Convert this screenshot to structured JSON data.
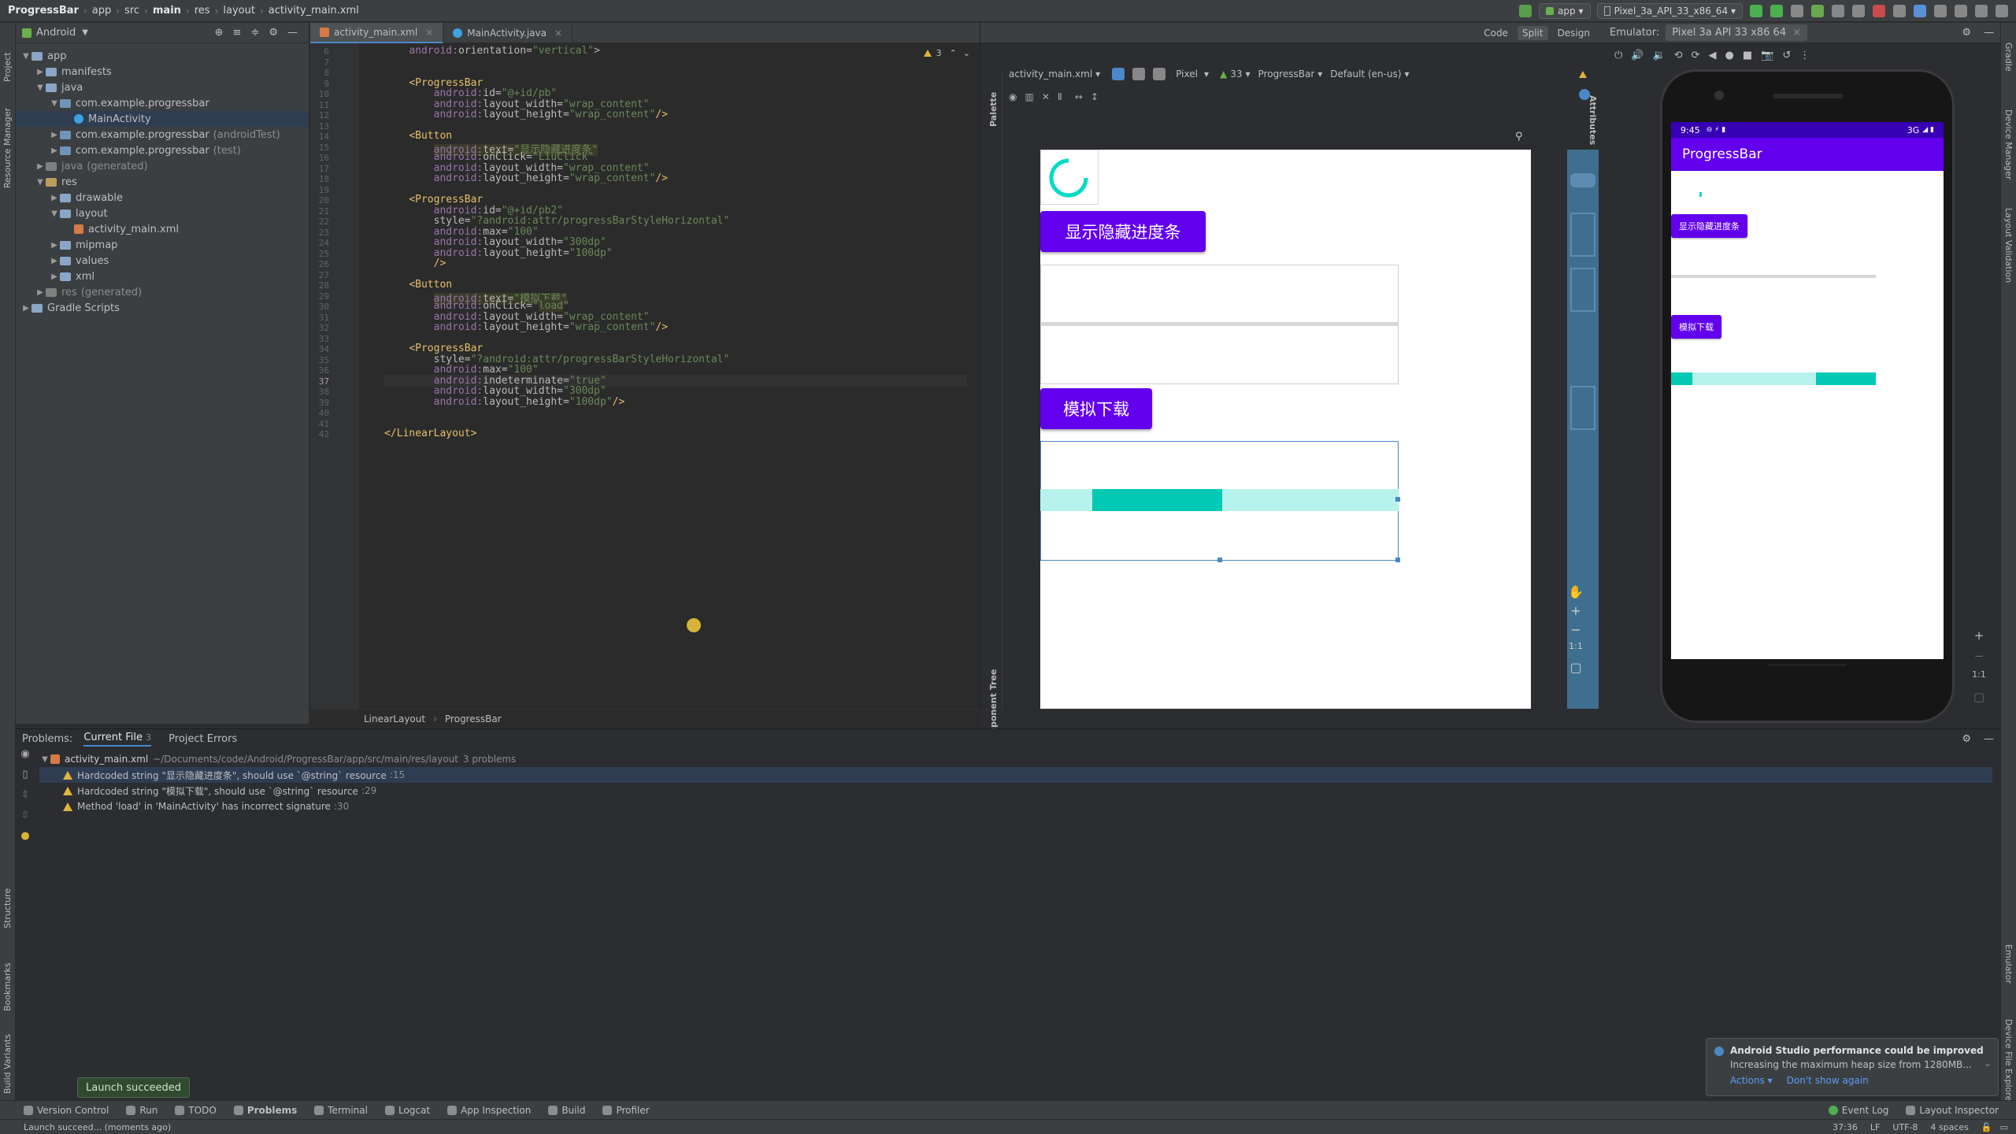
{
  "breadcrumb": [
    "ProgressBar",
    "app",
    "src",
    "main",
    "res",
    "layout",
    "activity_main.xml"
  ],
  "toolbar": {
    "run_config": "app",
    "device": "Pixel_3a_API_33_x86_64"
  },
  "project": {
    "view_label": "Android",
    "tree": [
      {
        "label": "app",
        "indent": 0,
        "kind": "folder",
        "open": true
      },
      {
        "label": "manifests",
        "indent": 1,
        "kind": "folder"
      },
      {
        "label": "java",
        "indent": 1,
        "kind": "folder",
        "open": true
      },
      {
        "label": "com.example.progressbar",
        "indent": 2,
        "kind": "pkg",
        "open": true
      },
      {
        "label": "MainActivity",
        "indent": 3,
        "kind": "class",
        "selected": true
      },
      {
        "label": "com.example.progressbar",
        "suffix": "(androidTest)",
        "indent": 2,
        "kind": "pkg"
      },
      {
        "label": "com.example.progressbar",
        "suffix": "(test)",
        "indent": 2,
        "kind": "pkg"
      },
      {
        "label": "java",
        "suffix": "(generated)",
        "indent": 1,
        "kind": "gen"
      },
      {
        "label": "res",
        "indent": 1,
        "kind": "res",
        "open": true
      },
      {
        "label": "drawable",
        "indent": 2,
        "kind": "folder"
      },
      {
        "label": "layout",
        "indent": 2,
        "kind": "folder",
        "open": true
      },
      {
        "label": "activity_main.xml",
        "indent": 3,
        "kind": "xml"
      },
      {
        "label": "mipmap",
        "indent": 2,
        "kind": "folder"
      },
      {
        "label": "values",
        "indent": 2,
        "kind": "folder"
      },
      {
        "label": "xml",
        "indent": 2,
        "kind": "folder"
      },
      {
        "label": "res",
        "suffix": "(generated)",
        "indent": 1,
        "kind": "gen"
      },
      {
        "label": "Gradle Scripts",
        "indent": 0,
        "kind": "gradle"
      }
    ]
  },
  "editor": {
    "tabs": [
      "activity_main.xml",
      "MainActivity.java"
    ],
    "warning_count": "3",
    "lines": [
      {
        "n": "6",
        "html": "    <span class='attr-ns'>android:</span><span class='attr'>orientation=</span><span class='val'>\"vertical\"</span>&gt;"
      },
      {
        "n": "7",
        "html": ""
      },
      {
        "n": "8",
        "html": ""
      },
      {
        "n": "9",
        "html": "    <span class='tag'>&lt;ProgressBar</span>"
      },
      {
        "n": "10",
        "html": "        <span class='attr-ns'>android:</span><span class='attr'>id=</span><span class='val'>\"@+id/pb\"</span>"
      },
      {
        "n": "11",
        "html": "        <span class='attr-ns'>android:</span><span class='attr'>layout_width=</span><span class='val'>\"wrap_content\"</span>"
      },
      {
        "n": "12",
        "html": "        <span class='attr-ns'>android:</span><span class='attr'>layout_height=</span><span class='val'>\"wrap_content\"</span><span class='tag'>/&gt;</span>"
      },
      {
        "n": "13",
        "html": ""
      },
      {
        "n": "14",
        "html": "    <span class='tag'>&lt;Button</span>"
      },
      {
        "n": "15",
        "html": "        <span class='hl'><span class='attr-ns'>android:</span><span class='attr'>text=</span><span class='val'>\"显示隐藏进度条\"</span></span>"
      },
      {
        "n": "16",
        "html": "        <span class='attr-ns'>android:</span><span class='attr'>onClick=</span><span class='val'>\"LiuClick\"</span>"
      },
      {
        "n": "17",
        "html": "        <span class='attr-ns'>android:</span><span class='attr'>layout_width=</span><span class='val'>\"wrap_content\"</span>"
      },
      {
        "n": "18",
        "html": "        <span class='attr-ns'>android:</span><span class='attr'>layout_height=</span><span class='val'>\"wrap_content\"</span><span class='tag'>/&gt;</span>"
      },
      {
        "n": "19",
        "html": ""
      },
      {
        "n": "20",
        "html": "    <span class='tag'>&lt;ProgressBar</span>"
      },
      {
        "n": "21",
        "html": "        <span class='attr-ns'>android:</span><span class='attr'>id=</span><span class='val'>\"@+id/pb2\"</span>"
      },
      {
        "n": "22",
        "html": "        <span class='attr'>style=</span><span class='val'>\"?android:attr/progressBarStyleHorizontal\"</span>"
      },
      {
        "n": "23",
        "html": "        <span class='attr-ns'>android:</span><span class='attr'>max=</span><span class='val'>\"100\"</span>"
      },
      {
        "n": "24",
        "html": "        <span class='attr-ns'>android:</span><span class='attr'>layout_width=</span><span class='val'>\"300dp\"</span>"
      },
      {
        "n": "25",
        "html": "        <span class='attr-ns'>android:</span><span class='attr'>layout_height=</span><span class='val'>\"100dp\"</span>"
      },
      {
        "n": "26",
        "html": "        <span class='tag'>/&gt;</span>"
      },
      {
        "n": "27",
        "html": ""
      },
      {
        "n": "28",
        "html": "    <span class='tag'>&lt;Button</span>"
      },
      {
        "n": "29",
        "html": "        <span class='hl'><span class='attr-ns'>android:</span><span class='attr'>text=</span><span class='val'>\"模拟下载\"</span></span>"
      },
      {
        "n": "30",
        "html": "        <span class='attr-ns'>android:</span><span class='attr'>onClick=</span><span class='val'>\"<span class='hl'>load</span>\"</span>"
      },
      {
        "n": "31",
        "html": "        <span class='attr-ns'>android:</span><span class='attr'>layout_width=</span><span class='val'>\"wrap_content\"</span>"
      },
      {
        "n": "32",
        "html": "        <span class='attr-ns'>android:</span><span class='attr'>layout_height=</span><span class='val'>\"wrap_content\"</span><span class='tag'>/&gt;</span>"
      },
      {
        "n": "33",
        "html": ""
      },
      {
        "n": "34",
        "html": "    <span class='tag'>&lt;ProgressBar</span>"
      },
      {
        "n": "35",
        "html": "        <span class='attr'>style=</span><span class='val'>\"?android:attr/progressBarStyleHorizontal\"</span>"
      },
      {
        "n": "36",
        "html": "        <span class='attr-ns'>android:</span><span class='attr'>max=</span><span class='val'>\"100\"</span>"
      },
      {
        "n": "37",
        "html": "        <span class='attr-ns'>android:</span><span class='attr'>indeterminate=</span><span class='val'>\"true\"</span>"
      },
      {
        "n": "38",
        "html": "        <span class='attr-ns'>android:</span><span class='attr'>layout_width=</span><span class='val'>\"300dp\"</span>"
      },
      {
        "n": "39",
        "html": "        <span class='attr-ns'>android:</span><span class='attr'>layout_height=</span><span class='val'>\"100dp\"</span><span class='tag'>/&gt;</span>"
      },
      {
        "n": "40",
        "html": ""
      },
      {
        "n": "41",
        "html": ""
      },
      {
        "n": "42",
        "html": "<span class='tag'>&lt;/LinearLayout&gt;</span>"
      }
    ],
    "breadcrumb": [
      "LinearLayout",
      "ProgressBar"
    ]
  },
  "design": {
    "mode_code": "Code",
    "mode_split": "Split",
    "mode_design": "Design",
    "file_combo": "activity_main.xml",
    "device_combo": "Pixel",
    "api_combo": "33",
    "theme_combo": "ProgressBar",
    "locale_combo": "Default (en-us)",
    "palette_label": "Palette",
    "component_tree_label": "Component Tree",
    "attributes_label": "Attributes",
    "button1": "显示隐藏进度条",
    "button2": "模拟下载",
    "zoom_1to1": "1:1"
  },
  "emulator": {
    "label": "Emulator:",
    "device": "Pixel 3a API 33 x86 64",
    "status_time": "9:45",
    "status_right": "3G",
    "app_title": "ProgressBar",
    "button1": "显示隐藏进度条",
    "button2": "模拟下载",
    "zoom_1to1": "1:1"
  },
  "problems": {
    "title": "Problems:",
    "tabs": [
      "Current File",
      "Project Errors"
    ],
    "current_file_count": "3",
    "file": "activity_main.xml",
    "path": "~/Documents/code/Android/ProgressBar/app/src/main/res/layout",
    "count": "3 problems",
    "items": [
      {
        "text": "Hardcoded string \"显示隐藏进度条\", should use `@string` resource",
        "loc": ":15"
      },
      {
        "text": "Hardcoded string \"模拟下载\", should use `@string` resource",
        "loc": ":29"
      },
      {
        "text": "Method 'load' in 'MainActivity' has incorrect signature",
        "loc": ":30"
      }
    ]
  },
  "left_strip": [
    "Project",
    "Resource Manager",
    "Structure",
    "Bookmarks",
    "Build Variants"
  ],
  "right_strip": [
    "Gradle",
    "Device Manager",
    "Layout Validation",
    "Emulator",
    "Device File Explorer"
  ],
  "bottom_tabs": [
    "Version Control",
    "Run",
    "TODO",
    "Problems",
    "Terminal",
    "Logcat",
    "App Inspection",
    "Build",
    "Profiler"
  ],
  "bottom_right_tabs": [
    "Event Log",
    "Layout Inspector"
  ],
  "statusbar": {
    "message": "Launch succeed... (moments ago)",
    "position": "37:36",
    "line_sep": "LF",
    "encoding": "UTF-8",
    "indent": "4 spaces"
  },
  "toast": "Launch succeeded",
  "notification": {
    "title": "Android Studio performance could be improved",
    "body": "Increasing the maximum heap size from 1280MB...",
    "action1": "Actions",
    "action2": "Don't show again"
  },
  "colors": {
    "accent": "#6200ee",
    "status_purple": "#3700b3",
    "progress_teal": "#03dac5",
    "progress_track": "#b8f2ec"
  }
}
